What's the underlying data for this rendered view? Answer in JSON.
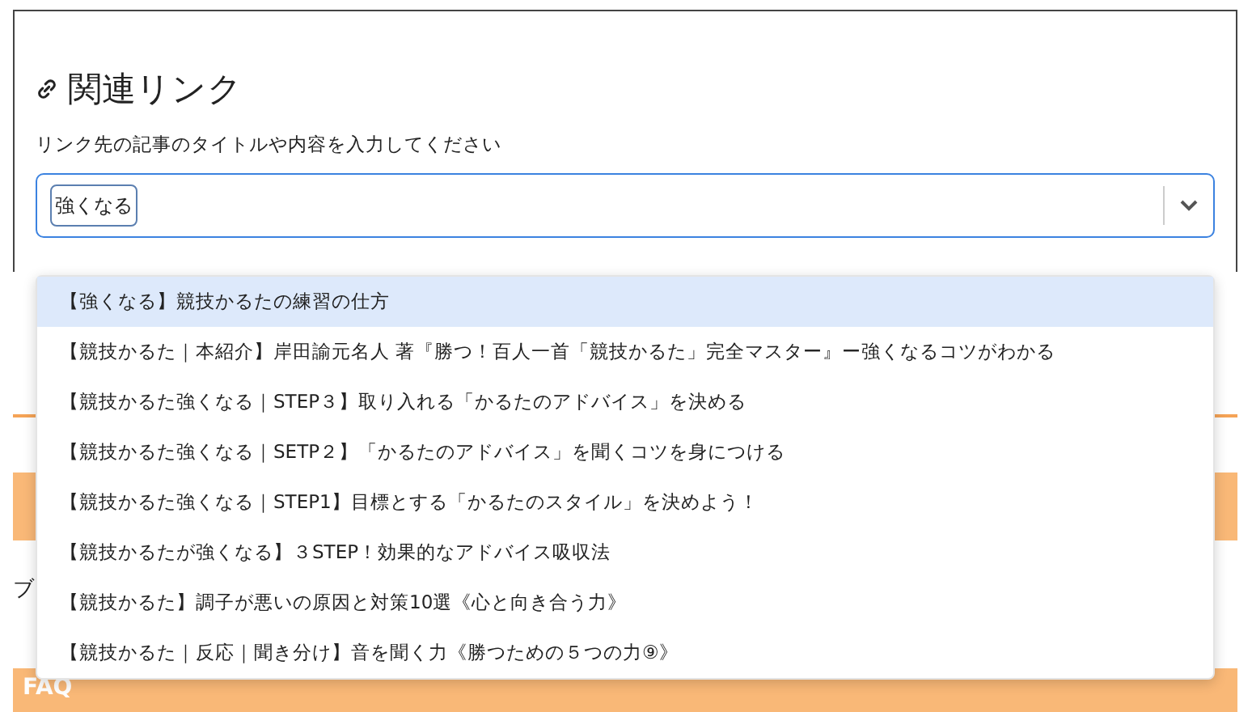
{
  "panel": {
    "title": "関連リンク",
    "hint": "リンク先の記事のタイトルや内容を入力してください",
    "search": {
      "value": "強くなる"
    }
  },
  "suggestions": [
    {
      "label": "【強くなる】競技かるたの練習の仕方",
      "selected": true
    },
    {
      "label": "【競技かるた｜本紹介】岸田諭元名人 著『勝つ！百人一首「競技かるた」完全マスター』ー強くなるコツがわかる",
      "selected": false
    },
    {
      "label": "【競技かるた強くなる｜STEP３】取り入れる「かるたのアドバイス」を決める",
      "selected": false
    },
    {
      "label": "【競技かるた強くなる｜SETP２】「かるたのアドバイス」を聞くコツを身につける",
      "selected": false
    },
    {
      "label": "【競技かるた強くなる｜STEP1】目標とする「かるたのスタイル」を決めよう！",
      "selected": false
    },
    {
      "label": "【競技かるたが強くなる】３STEP！効果的なアドバイス吸収法",
      "selected": false
    },
    {
      "label": "【競技かるた】調子が悪いの原因と対策10選《心と向き合う力》",
      "selected": false
    },
    {
      "label": "【競技かるた｜反応｜聞き分け】音を聞く力《勝つための５つの力⑨》",
      "selected": false
    }
  ],
  "background": {
    "paragraph": "ブ",
    "section_heading": "FAQ"
  }
}
